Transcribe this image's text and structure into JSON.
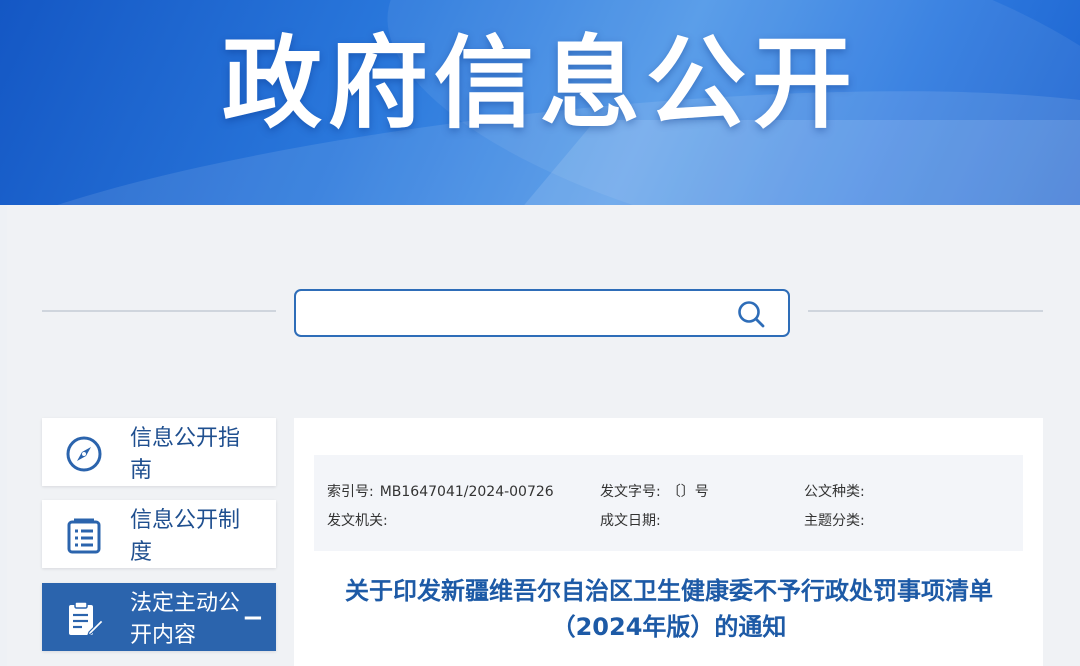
{
  "banner": {
    "title": "政府信息公开"
  },
  "search": {
    "placeholder": "",
    "value": ""
  },
  "sidebar": {
    "items": [
      {
        "label": "信息公开指南",
        "icon": "compass-icon"
      },
      {
        "label": "信息公开制度",
        "icon": "document-list-icon"
      },
      {
        "label": "法定主动公开内容",
        "icon": "clipboard-edit-icon",
        "toggle": "−"
      }
    ]
  },
  "meta": {
    "index_label": "索引号:",
    "index_value": "MB1647041/2024-00726",
    "doc_number_label": "发文字号:",
    "doc_number_value": "〔〕号",
    "doc_type_label": "公文种类:",
    "issuer_label": "发文机关:",
    "date_label": "成文日期:",
    "topic_label": "主题分类:"
  },
  "document": {
    "title": "关于印发新疆维吾尔自治区卫生健康委不予行政处罚事项清单（2024年版）的通知"
  },
  "colors": {
    "primary": "#2b64ad",
    "title": "#1d5aa6",
    "banner": "#2a78dc"
  }
}
